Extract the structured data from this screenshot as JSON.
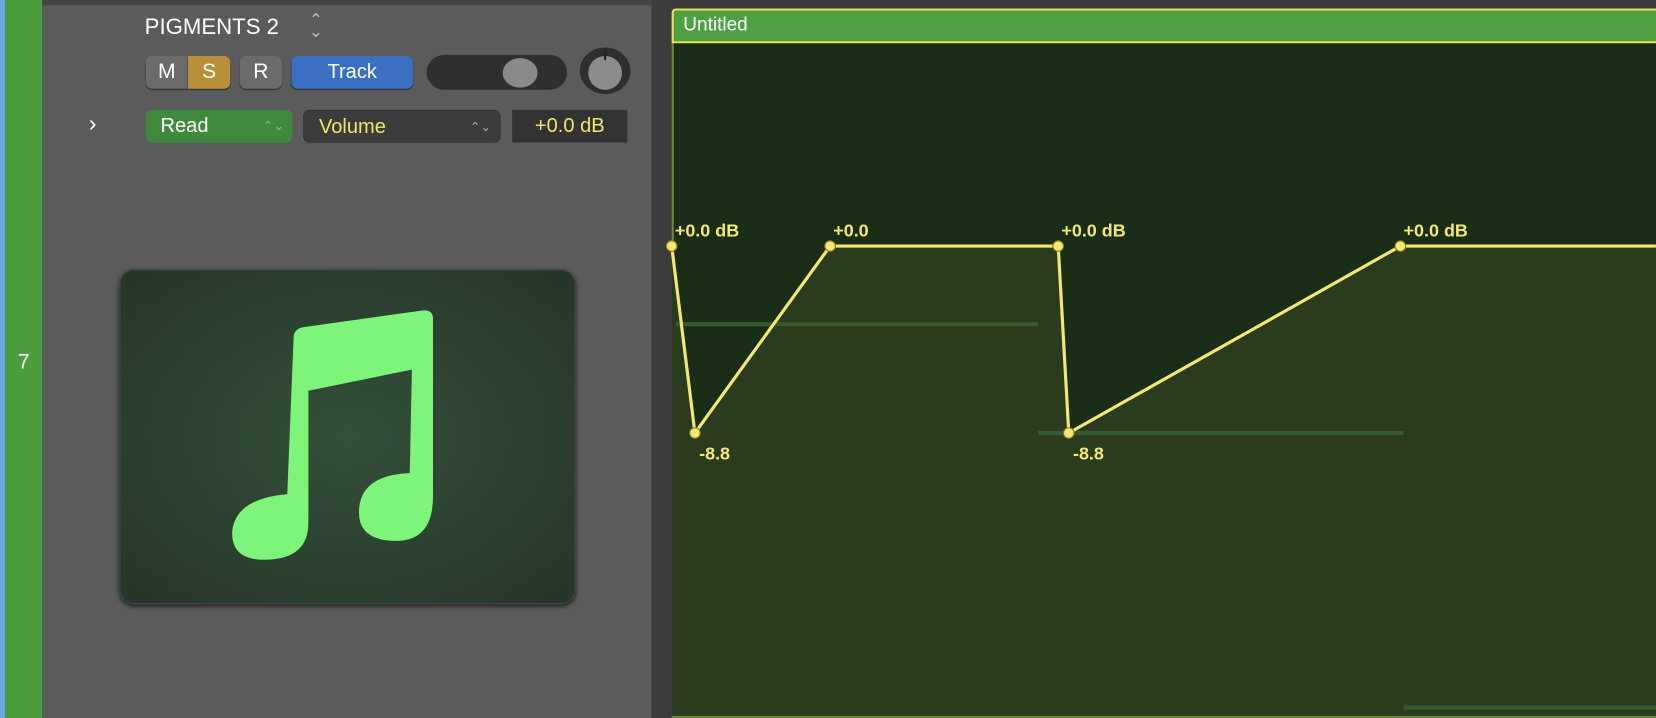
{
  "track": {
    "number": "7",
    "name": "PIGMENTS 2",
    "buttons": {
      "mute": "M",
      "solo": "S",
      "record": "R",
      "track": "Track"
    },
    "automation_mode": "Read",
    "automation_param": "Volume",
    "value": "+0.0 dB",
    "icon": "music-note-icon"
  },
  "region": {
    "title": "Untitled",
    "automation_points": [
      {
        "value_db": 0.0,
        "label": "+0.0 dB"
      },
      {
        "value_db": -8.8,
        "label": "-8.8"
      },
      {
        "value_db": 0.0,
        "label": "+0.0"
      },
      {
        "value_db": 0.0,
        "label": "+0.0 dB"
      },
      {
        "value_db": -8.8,
        "label": "-8.8"
      },
      {
        "value_db": 0.0,
        "label": "+0.0 dB"
      }
    ]
  },
  "colors": {
    "region": "#4fa043",
    "automation": "#f4e872",
    "solo": "#b8903a",
    "track_button": "#3b6fc2"
  }
}
